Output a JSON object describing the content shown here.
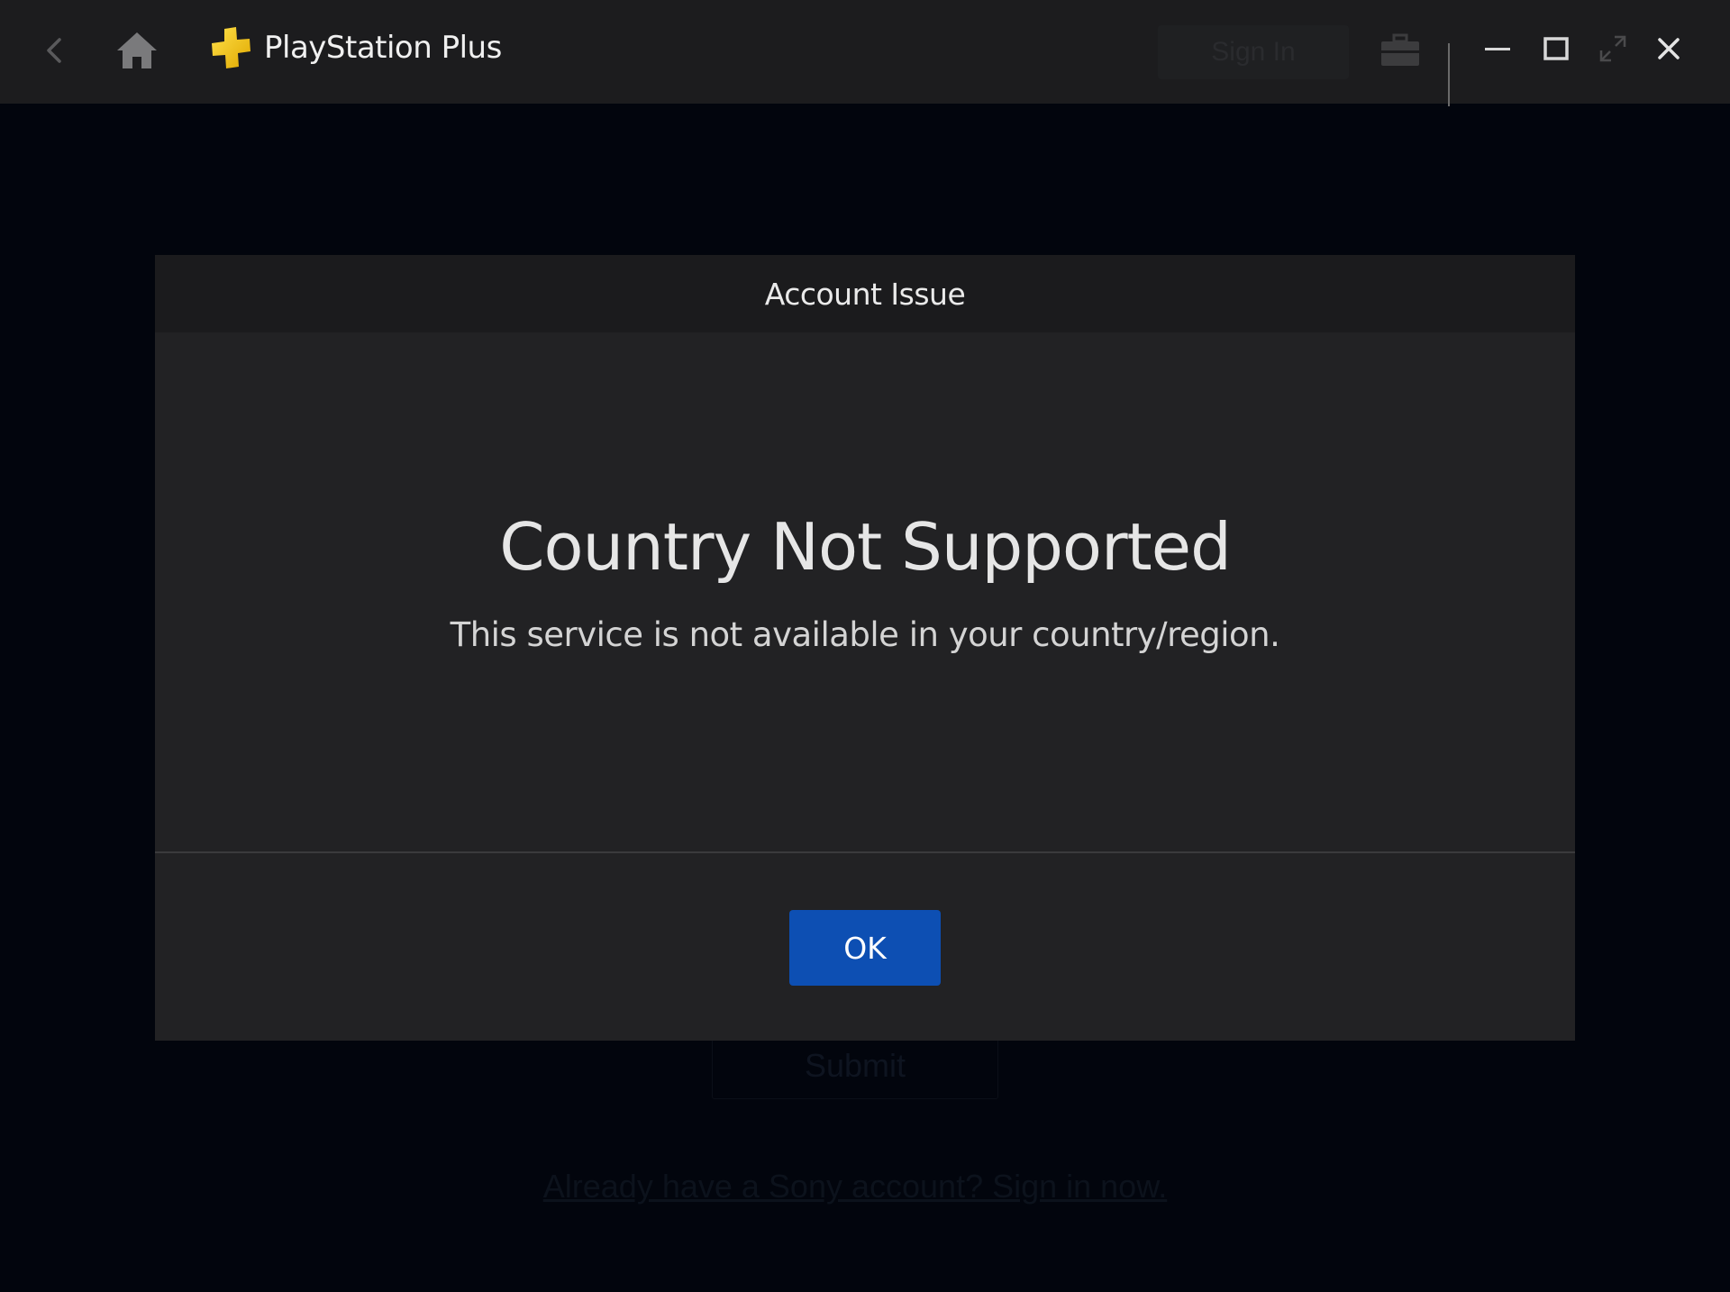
{
  "window": {
    "app_title": "PlayStation Plus",
    "sign_in_label": "Sign In"
  },
  "background_page": {
    "submit_label": "Submit",
    "sign_in_link": "Already have a Sony account? Sign in now."
  },
  "dialog": {
    "header_title": "Account Issue",
    "heading": "Country Not Supported",
    "message": "This service is not available in your country/region.",
    "ok_label": "OK"
  },
  "colors": {
    "titlebar_bg": "#1c1c1e",
    "page_bg": "#02050d",
    "dialog_bg": "#222224",
    "dialog_header_bg": "#1b1b1d",
    "primary_button": "#0d4fb3",
    "logo_yellow": "#f5c400"
  },
  "icons": {
    "back": "chevron-left-icon",
    "home": "home-icon",
    "logo": "playstation-plus-logo",
    "briefcase": "briefcase-icon",
    "minimize": "minimize-icon",
    "maximize": "maximize-icon",
    "fullscreen": "fullscreen-icon",
    "close": "close-icon"
  }
}
